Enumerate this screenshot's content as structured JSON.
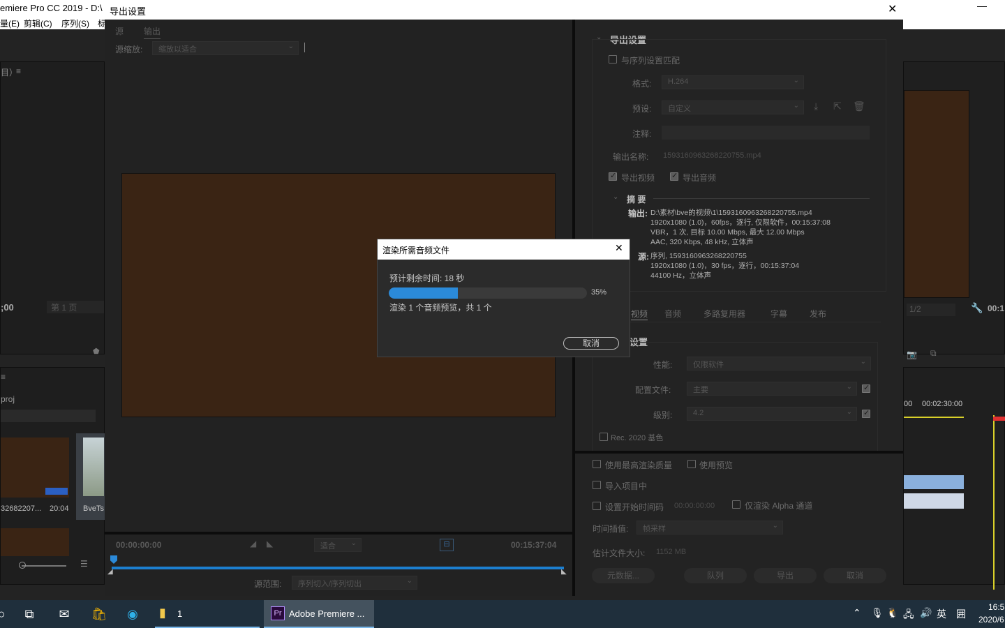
{
  "background_app": {
    "title": "emiere Pro CC 2019 - D:\\",
    "minimize_glyph": "—",
    "menu": [
      "量(E)",
      "剪辑(C)",
      "序列(S)",
      "标"
    ],
    "left_panel_label": "目）",
    "timecode_left": ";00",
    "page_label": "第 1 页",
    "project_label": "proj",
    "clip_name": "32682207...",
    "clip_duration": "20:04",
    "clip2_name": "BveTs",
    "right_timecode": "00:1",
    "right_page": "1/2",
    "timeline_time_a": "00",
    "timeline_time_b": "00:02:30:00"
  },
  "export_dialog": {
    "title": "导出设置",
    "close_glyph": "✕",
    "tabs": [
      "源",
      "输出"
    ],
    "source_scale_label": "源缩放:",
    "source_scale_value": "缩放以适合",
    "timecode_start": "00:00:00:00",
    "timecode_end": "00:15:37:04",
    "fit_value": "适合",
    "source_range_label": "源范围:",
    "source_range_value": "序列切入/序列切出",
    "settings_header": "导出设置",
    "match_sequence_label": "与序列设置匹配",
    "format_label": "格式:",
    "format_value": "H.264",
    "preset_label": "预设:",
    "preset_value": "自定义",
    "comments_label": "注释:",
    "output_name_label": "输出名称:",
    "output_name_value": "1593160963268220755.mp4",
    "export_video_label": "导出视频",
    "export_audio_label": "导出音频",
    "summary_header": "摘 要",
    "summary_output_label": "输出:",
    "summary_output_lines": [
      "D:\\素材\\bve的视频\\1\\1593160963268220755.mp4",
      "1920x1080 (1.0)，60fps，逐行, 仅限软件，00:15:37:08",
      "VBR，1 次, 目标 10.00 Mbps, 最大 12.00 Mbps",
      "AAC, 320 Kbps, 48  kHz, 立体声"
    ],
    "summary_source_label": "源:",
    "summary_source_lines": [
      "序列, 1593160963268220755",
      "1920x1080 (1.0)，30 fps，逐行，00:15:37:04",
      "44100 Hz，立体声"
    ],
    "settings_tabs": [
      "视频",
      "音频",
      "多路复用器",
      "字幕",
      "发布"
    ],
    "encoding_header": "设置",
    "performance_label": "性能:",
    "performance_value": "仅限软件",
    "profile_label": "配置文件:",
    "profile_value": "主要",
    "level_label": "级别:",
    "level_value": "4.2",
    "rec2020_label": "Rec. 2020 基色",
    "max_quality_label": "使用最高渲染质量",
    "use_previews_label": "使用预览",
    "import_project_label": "导入项目中",
    "start_timecode_label": "设置开始时间码",
    "start_timecode_value": "00:00:00:00",
    "alpha_label": "仅渲染 Alpha 通道",
    "interp_label": "时间插值:",
    "interp_value": "帧采样",
    "filesize_label": "估计文件大小:",
    "filesize_value": "1152 MB",
    "btn_metadata": "元数据...",
    "btn_queue": "队列",
    "btn_export": "导出",
    "btn_cancel": "取消"
  },
  "modal": {
    "title": "渲染所需音频文件",
    "close_glyph": "✕",
    "eta_text": "预计剩余时间: 18 秒",
    "progress_percent": 35,
    "progress_label": "35%",
    "status_text": "渲染 1 个音频预览，共 1 个",
    "cancel_label": "取消"
  },
  "taskbar": {
    "files_label": "1",
    "premiere_label": "Adobe Premiere ...",
    "ime_label": "英",
    "time": "16:5",
    "date": "2020/6"
  },
  "colors": {
    "accent_blue": "#2b8ad9",
    "preview_brown": "#3a2414",
    "taskbar": "#1f2f3c"
  }
}
